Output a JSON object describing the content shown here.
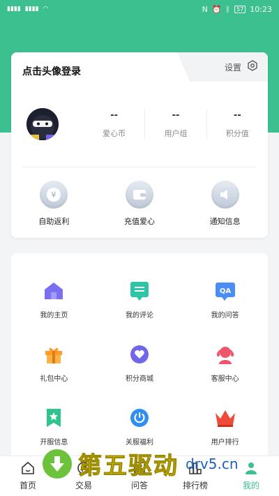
{
  "status_bar": {
    "time": "10:23",
    "battery": "57",
    "signal": "4G 4G"
  },
  "profile": {
    "login_prompt": "点击头像登录",
    "settings_label": "设置",
    "stats": [
      {
        "value": "--",
        "label": "爱心币"
      },
      {
        "value": "--",
        "label": "用户组"
      },
      {
        "value": "--",
        "label": "积分值"
      }
    ],
    "actions": [
      {
        "label": "自助返利",
        "icon": "yen-coin-icon"
      },
      {
        "label": "充值爱心",
        "icon": "wallet-icon"
      },
      {
        "label": "通知信息",
        "icon": "speaker-icon"
      }
    ]
  },
  "menu": [
    {
      "label": "我的主页",
      "icon": "home-icon",
      "color": "#7a6ff0"
    },
    {
      "label": "我的评论",
      "icon": "comment-icon",
      "color": "#2fc4a6"
    },
    {
      "label": "我的问答",
      "icon": "qa-icon",
      "color": "#4a8ef5"
    },
    {
      "label": "礼包中心",
      "icon": "gift-icon",
      "color": "#ff9c2a"
    },
    {
      "label": "积分商城",
      "icon": "heart-shop-icon",
      "color": "#6f67e8"
    },
    {
      "label": "客服中心",
      "icon": "headset-icon",
      "color": "#f0566b"
    },
    {
      "label": "开服信息",
      "icon": "bookmark-star-icon",
      "color": "#2fc48e"
    },
    {
      "label": "关服福利",
      "icon": "power-icon",
      "color": "#2f8ef0"
    },
    {
      "label": "用户排行",
      "icon": "crown-icon",
      "color": "#f04a3a"
    }
  ],
  "tabs": [
    {
      "label": "首页",
      "icon": "home-outline-icon"
    },
    {
      "label": "交易",
      "icon": "exchange-icon"
    },
    {
      "label": "问答",
      "icon": "doc-icon"
    },
    {
      "label": "排行榜",
      "icon": "ranking-icon"
    },
    {
      "label": "我的",
      "icon": "person-icon",
      "active": true
    }
  ],
  "watermark": {
    "text": "第五驱动",
    "url": "drv5.cn"
  },
  "colors": {
    "brand": "#3cc08f",
    "active_tab": "#3cc08f"
  }
}
